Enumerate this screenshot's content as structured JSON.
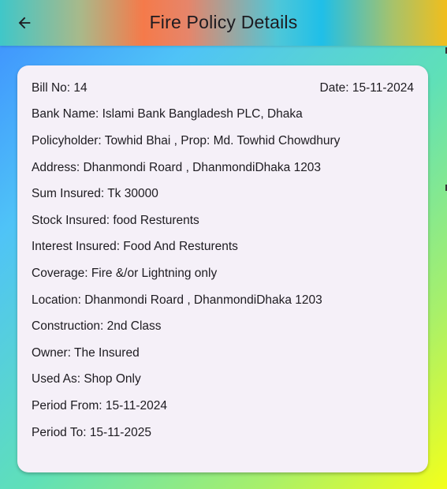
{
  "appbar": {
    "title": "Fire Policy Details",
    "back_icon": "arrow-left-icon"
  },
  "policy": {
    "bill_no": "Bill No: 14",
    "date": "Date: 15-11-2024",
    "bank_name": "Bank Name: Islami Bank Bangladesh PLC, Dhaka",
    "policyholder": "Policyholder: Towhid Bhai , Prop: Md. Towhid Chowdhury",
    "address": "Address: Dhanmondi Roard , DhanmondiDhaka 1203",
    "sum_insured": "Sum Insured: Tk 30000",
    "stock_insured": "Stock Insured: food Resturents",
    "interest_insured": "Interest Insured: Food And Resturents",
    "coverage": "Coverage: Fire &/or Lightning only",
    "location": "Location: Dhanmondi Roard , DhanmondiDhaka 1203",
    "construction": "Construction: 2nd Class",
    "owner": "Owner: The Insured",
    "used_as": "Used As: Shop Only",
    "period_from": "Period From: 15-11-2024",
    "period_to": "Period To: 15-11-2025"
  },
  "colors": {
    "text": "#1d1b20",
    "card": "#f5f0f8"
  }
}
